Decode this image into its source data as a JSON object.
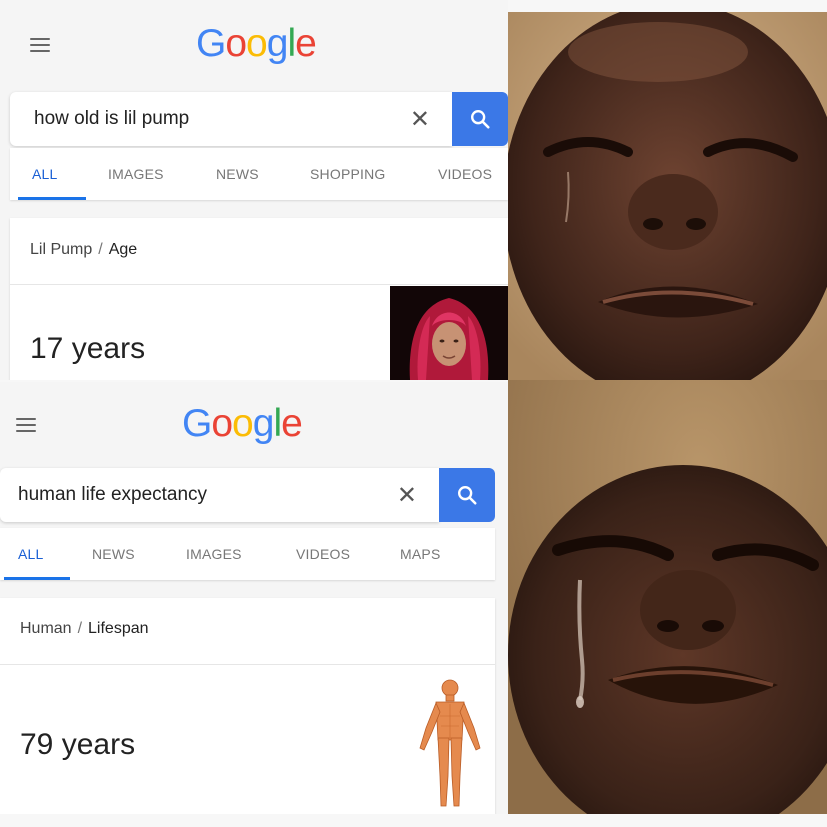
{
  "top": {
    "logo": "Google",
    "query": "how old is lil pump",
    "tabs": [
      "ALL",
      "IMAGES",
      "NEWS",
      "SHOPPING",
      "VIDEOS"
    ],
    "active_tab": "ALL",
    "breadcrumb": {
      "entity": "Lil Pump",
      "separator": "/",
      "attribute": "Age"
    },
    "answer": "17 years"
  },
  "bottom": {
    "logo": "Google",
    "query": "human life expectancy",
    "tabs": [
      "ALL",
      "NEWS",
      "IMAGES",
      "VIDEOS",
      "MAPS"
    ],
    "active_tab": "ALL",
    "breadcrumb": {
      "entity": "Human",
      "separator": "/",
      "attribute": "Lifespan"
    },
    "answer": "79 years"
  },
  "icons": {
    "menu": "hamburger-menu-icon",
    "clear": "close-icon",
    "search": "search-icon"
  },
  "colors": {
    "search_button": "#3b78e7",
    "active_tab": "#1a5fd4",
    "google_blue": "#4285F4",
    "google_red": "#EA4335",
    "google_yellow": "#FBBC05",
    "google_green": "#34A853"
  }
}
